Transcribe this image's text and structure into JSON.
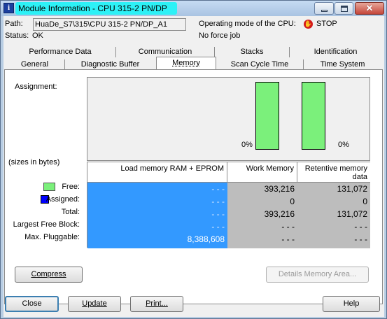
{
  "window": {
    "title": "Module Information - CPU 315-2 PN/DP",
    "close_glyph": "✕"
  },
  "header": {
    "path_label": "Path:",
    "path_value": "HuaDe_S7\\315\\CPU 315-2 PN/DP_A1",
    "status_label": "Status:",
    "status_value": "OK",
    "op_mode_label": "Operating mode of the  CPU:",
    "op_mode_value": "STOP",
    "force_value": "No force job"
  },
  "tabs": {
    "row1": [
      "Performance Data",
      "Communication",
      "Stacks",
      "Identification"
    ],
    "row2": [
      "General",
      "Diagnostic Buffer",
      "Memory",
      "Scan Cycle Time",
      "Time System"
    ],
    "selected": "Memory"
  },
  "memory": {
    "assignment_label": "Assignment:",
    "sizes_label": "(sizes in bytes)",
    "bars": [
      {
        "name": "Work Memory",
        "used_percent": "0%",
        "free_fraction": 1.0
      },
      {
        "name": "Retentive memory data",
        "used_percent": "0%",
        "free_fraction": 1.0
      }
    ],
    "columns": [
      "Load memory RAM + EPROM",
      "Work Memory",
      "Retentive memory data"
    ],
    "row_labels": [
      "Free:",
      "Assigned:",
      "Total:",
      "Largest Free Block:",
      "Max. Pluggable:"
    ],
    "legend": {
      "free_color": "#7bf07b",
      "assigned_color": "#0000ff"
    },
    "load": [
      "- - -",
      "- - -",
      "- - -",
      "- - -",
      "8,388,608"
    ],
    "work": [
      "393,216",
      "0",
      "393,216",
      "- - -",
      "- - -"
    ],
    "retentive": [
      "131,072",
      "0",
      "131,072",
      "- - -",
      "- - -"
    ]
  },
  "panel_buttons": {
    "compress": "Compress",
    "details": "Details Memory Area..."
  },
  "footer": {
    "close": "Close",
    "update": "Update",
    "print": "Print...",
    "help": "Help"
  }
}
